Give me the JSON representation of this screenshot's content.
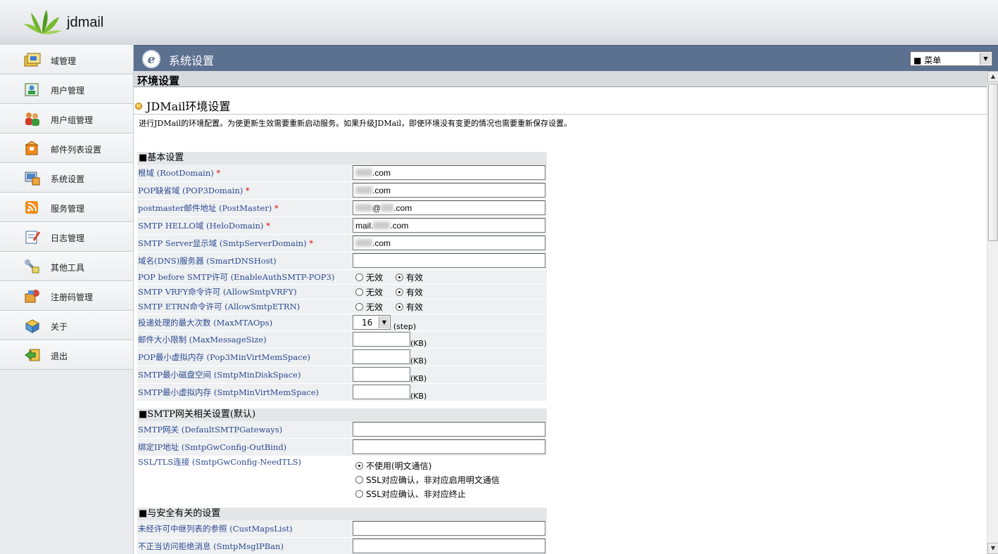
{
  "app": {
    "brand": "jdmail"
  },
  "sidebar": {
    "items": [
      {
        "label": "域管理",
        "icon": "domain-icon"
      },
      {
        "label": "用户管理",
        "icon": "user-icon"
      },
      {
        "label": "用户组管理",
        "icon": "user-group-icon"
      },
      {
        "label": "邮件列表设置",
        "icon": "mailing-list-icon"
      },
      {
        "label": "系统设置",
        "icon": "system-settings-icon"
      },
      {
        "label": "服务管理",
        "icon": "service-icon"
      },
      {
        "label": "日志管理",
        "icon": "log-icon"
      },
      {
        "label": "其他工具",
        "icon": "tools-icon"
      },
      {
        "label": "注册码管理",
        "icon": "license-icon"
      },
      {
        "label": "关于",
        "icon": "about-icon"
      },
      {
        "label": "退出",
        "icon": "logout-icon"
      }
    ]
  },
  "header": {
    "title": "系统设置",
    "menu_select": "■ 菜单"
  },
  "section": {
    "title": "环境设置"
  },
  "page": {
    "subtitle": "JDMail环境设置",
    "description": "进行JDMail的环境配置。为使更新生效需要重新启动服务。如果升级JDMail，即使环境没有变更的情况也需要重新保存设置。"
  },
  "basic": {
    "title": "■基本设置",
    "root_domain": {
      "label": "根域 (RootDomain)",
      "req": "*",
      "value_suffix": ".com"
    },
    "pop3_domain": {
      "label": "POP缺省域 (POP3Domain)",
      "req": "*",
      "value_suffix": ".com"
    },
    "postmaster": {
      "label": "postmaster邮件地址 (PostMaster)",
      "req": "*",
      "at": "@",
      "value_suffix": ".com"
    },
    "helo": {
      "label": "SMTP HELLO域 (HeloDomain)",
      "req": "*",
      "prefix": "mail.",
      "value_suffix": ".com"
    },
    "smtp_server_domain": {
      "label": "SMTP Server显示域 (SmtpServerDomain)",
      "req": "*",
      "value_suffix": ".com"
    },
    "dns": {
      "label": "域名(DNS)服务器 (SmartDNSHost)",
      "value": ""
    },
    "pop_before_smtp": {
      "label": "POP before SMTP许可 (EnableAuthSMTP-POP3)",
      "opt_off": "无效",
      "opt_on": "有效",
      "selected": "有效"
    },
    "vrfy": {
      "label": "SMTP VRFY命令许可 (AllowSmtpVRFY)",
      "opt_off": "无效",
      "opt_on": "有效",
      "selected": "有效"
    },
    "etrn": {
      "label": "SMTP ETRN命令许可 (AllowSmtpETRN)",
      "opt_off": "无效",
      "opt_on": "有效",
      "selected": "有效"
    },
    "max_mta": {
      "label": "投递处理的最大次数 (MaxMTAOps)",
      "value": "16",
      "unit": "(step)"
    },
    "max_msg": {
      "label": "邮件大小限制 (MaxMessageSize)",
      "unit": "(KB)"
    },
    "pop3_mem": {
      "label": "POP最小虚拟内存 (Pop3MinVirtMemSpace)",
      "unit": "(KB)"
    },
    "smtp_disk": {
      "label": "SMTP最小磁盘空间 (SmtpMinDiskSpace)",
      "unit": "(KB)"
    },
    "smtp_mem": {
      "label": "SMTP最小虚拟内存 (SmtpMinVirtMemSpace)",
      "unit": "(KB)"
    }
  },
  "gateway": {
    "title": "■SMTP网关相关设置(默认)",
    "gateways": {
      "label": "SMTP网关 (DefaultSMTPGateways)",
      "value": ""
    },
    "outbind": {
      "label": "绑定IP地址 (SmtpGwConfig-OutBind)",
      "value": ""
    },
    "tls": {
      "label": "SSL/TLS连接 (SmtpGwConfig-NeedTLS)",
      "options": [
        "不使用(明文通信)",
        "SSL对应确认，非对应启用明文通信",
        "SSL对应确认、非对应终止"
      ],
      "selected": "不使用(明文通信)"
    }
  },
  "security": {
    "title": "■与安全有关的设置",
    "cust_maps": {
      "label": "未经许可中继列表的参照 (CustMapsList)",
      "value": ""
    },
    "ip_ban": {
      "label": "不正当访问拒绝消息 (SmtpMsgIPBan)",
      "value": ""
    }
  },
  "colors": {
    "titlebar": "#5c7090",
    "label": "#2b4a92",
    "required": "#dd0000"
  }
}
